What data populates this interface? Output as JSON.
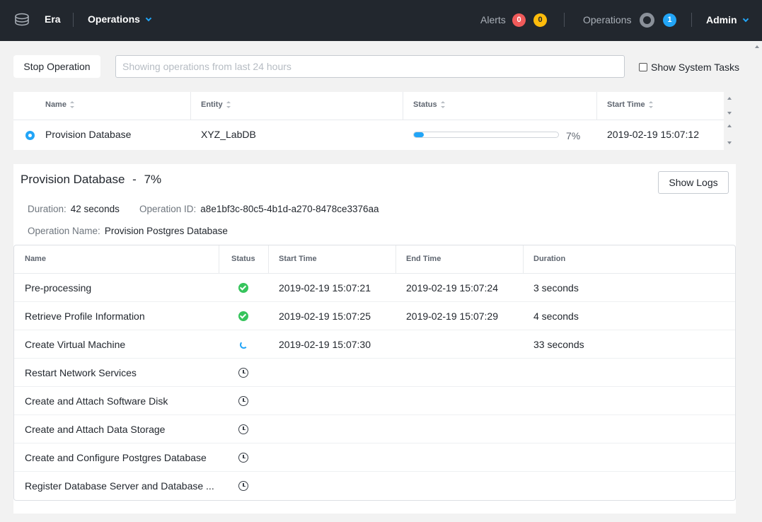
{
  "header": {
    "app_name": "Era",
    "nav_menu": "Operations",
    "alerts_label": "Alerts",
    "alerts_critical": "0",
    "alerts_warning": "0",
    "operations_label": "Operations",
    "operations_count": "1",
    "user_menu": "Admin"
  },
  "toolbar": {
    "stop_label": "Stop Operation",
    "search_placeholder": "Showing operations from last 24 hours",
    "search_value": "",
    "show_system_tasks_label": "Show System Tasks",
    "show_system_tasks_checked": false
  },
  "operations": {
    "columns": [
      "Name",
      "Entity",
      "Status",
      "Start Time"
    ],
    "rows": [
      {
        "name": "Provision Database",
        "entity": "XYZ_LabDB",
        "progress": 7,
        "progress_label": "7%",
        "start_time": "2019-02-19 15:07:12"
      }
    ]
  },
  "detail": {
    "title": "Provision Database",
    "title_sep": "-",
    "title_pct": "7%",
    "show_logs_label": "Show Logs",
    "duration_label": "Duration:",
    "duration_value": "42 seconds",
    "operation_id_label": "Operation ID:",
    "operation_id_value": "a8e1bf3c-80c5-4b1d-a270-8478ce3376aa",
    "operation_name_label": "Operation Name:",
    "operation_name_value": "Provision Postgres Database",
    "steps_columns": [
      "Name",
      "Status",
      "Start Time",
      "End Time",
      "Duration"
    ],
    "steps": [
      {
        "name": "Pre-processing",
        "status": "success",
        "start": "2019-02-19 15:07:21",
        "end": "2019-02-19 15:07:24",
        "duration": "3 seconds"
      },
      {
        "name": "Retrieve Profile Information",
        "status": "success",
        "start": "2019-02-19 15:07:25",
        "end": "2019-02-19 15:07:29",
        "duration": "4 seconds"
      },
      {
        "name": "Create Virtual Machine",
        "status": "running",
        "start": "2019-02-19 15:07:30",
        "end": "",
        "duration": "33 seconds"
      },
      {
        "name": "Restart Network Services",
        "status": "pending",
        "start": "",
        "end": "",
        "duration": ""
      },
      {
        "name": "Create and Attach Software Disk",
        "status": "pending",
        "start": "",
        "end": "",
        "duration": ""
      },
      {
        "name": "Create and Attach Data Storage",
        "status": "pending",
        "start": "",
        "end": "",
        "duration": ""
      },
      {
        "name": "Create and Configure Postgres Database",
        "status": "pending",
        "start": "",
        "end": "",
        "duration": ""
      },
      {
        "name": "Register Database Server and Database ...",
        "status": "pending",
        "start": "",
        "end": "",
        "duration": ""
      }
    ]
  }
}
